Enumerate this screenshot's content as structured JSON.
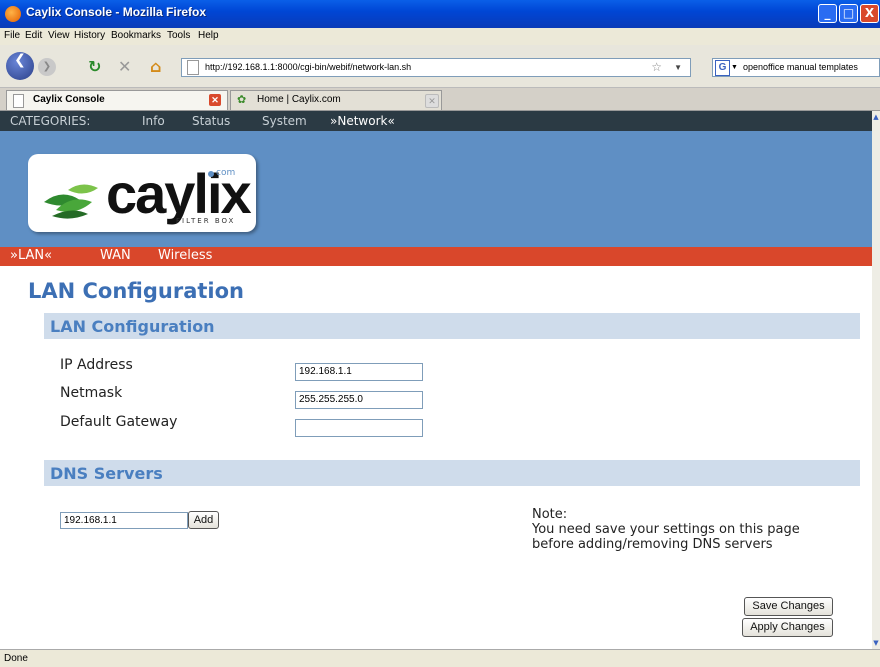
{
  "window": {
    "title": "Caylix Console - Mozilla Firefox",
    "controls": [
      "_",
      "□",
      "X"
    ]
  },
  "menu": [
    "File",
    "Edit",
    "View",
    "History",
    "Bookmarks",
    "Tools",
    "Help"
  ],
  "nav": {
    "url": "http://192.168.1.1:8000/cgi-bin/webif/network-lan.sh",
    "search_text": "openoffice manual templates",
    "icons": [
      "back-icon",
      "forward-icon",
      "reload-icon",
      "stop-icon",
      "home-icon",
      "star-icon",
      "google-icon",
      "search-icon"
    ]
  },
  "tabs": [
    {
      "label": "Caylix Console",
      "active": true
    },
    {
      "label": "Home | Caylix.com",
      "active": false
    }
  ],
  "page": {
    "categories_label": "CATEGORIES:",
    "categories": [
      "Info",
      "Status",
      "System",
      "»Network«"
    ],
    "logo": {
      "text": "caylix",
      "dotcom": "com",
      "tagline": "FILTER BOX"
    },
    "subnav": [
      "»LAN«",
      "WAN",
      "Wireless"
    ],
    "title": "LAN Configuration",
    "lan_section": "LAN Configuration",
    "fields": [
      {
        "label": "IP Address",
        "value": "192.168.1.1"
      },
      {
        "label": "Netmask",
        "value": "255.255.255.0"
      },
      {
        "label": "Default Gateway",
        "value": ""
      }
    ],
    "dns_section": "DNS Servers",
    "dns_value": "192.168.1.1",
    "add_button": "Add",
    "note_title": "Note:",
    "note_line1": "You need save your settings on this page",
    "note_line2": "before adding/removing DNS servers",
    "save_button": "Save Changes",
    "apply_button": "Apply Changes"
  },
  "colors": {
    "category_bar": "#2b3a44",
    "banner": "#5f8fc4",
    "subnav": "#d9472b",
    "section_header": "#cfdceb",
    "heading": "#3c6fb4"
  },
  "status": "Done"
}
